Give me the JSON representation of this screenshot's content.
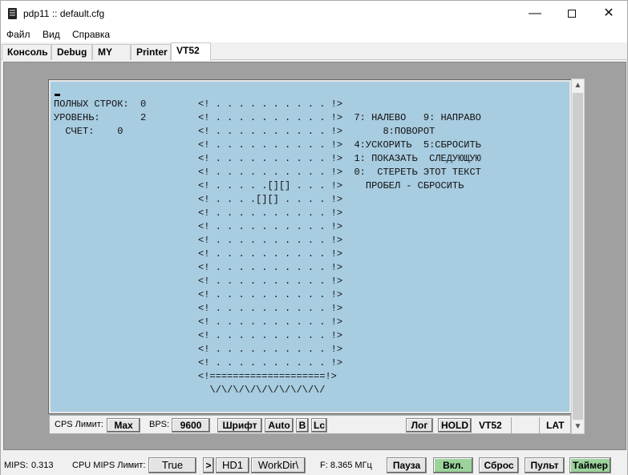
{
  "window": {
    "title": "pdp11 :: default.cfg",
    "minimize": "—",
    "close": "✕"
  },
  "menu": [
    "Файл",
    "Вид",
    "Справка"
  ],
  "tabs": [
    "Консоль",
    "Debug",
    "MY",
    "Printer",
    "VT52"
  ],
  "active_tab": "VT52",
  "terminal": {
    "lines": [
      "ПОЛНЫХ СТРОК:  0         <! . . . . . . . . . . !>",
      "УРОВЕНЬ:       2         <! . . . . . . . . . . !>  7: НАЛЕВО   9: НАПРАВО",
      "  СЧЕТ:    0             <! . . . . . . . . . . !>       8:ПОВОРОТ",
      "                         <! . . . . . . . . . . !>  4:УСКОРИТЬ  5:СБРОСИТЬ",
      "                         <! . . . . . . . . . . !>  1: ПОКАЗАТЬ  СЛЕДУЮЩУЮ",
      "                         <! . . . . . . . . . . !>  0:  СТЕРЕТЬ ЭТОТ ТЕКСТ",
      "                         <! . . . . .[][] . . . !>    ПРОБЕЛ - СБРОСИТЬ",
      "                         <! . . . .[][] . . . . !>",
      "                         <! . . . . . . . . . . !>",
      "                         <! . . . . . . . . . . !>",
      "                         <! . . . . . . . . . . !>",
      "                         <! . . . . . . . . . . !>",
      "                         <! . . . . . . . . . . !>",
      "                         <! . . . . . . . . . . !>",
      "                         <! . . . . . . . . . . !>",
      "                         <! . . . . . . . . . . !>",
      "                         <! . . . . . . . . . . !>",
      "                         <! . . . . . . . . . . !>",
      "                         <! . . . . . . . . . . !>",
      "                         <! . . . . . . . . . . !>",
      "                         <!====================!>",
      "                           \\/\\/\\/\\/\\/\\/\\/\\/\\/\\/"
    ],
    "screen_color": "#a8cce0"
  },
  "termbar": {
    "cps_label": "CPS Лимит:",
    "cps_value": "Max",
    "bps_label": "BPS:",
    "bps_value": "9600",
    "font_button": "Шрифт",
    "auto_button": "Auto",
    "b_button": "B",
    "lc_button": "Lc",
    "log_button": "Лог",
    "hold_button": "HOLD",
    "vt52_label": "VT52",
    "lat_label": "LAT"
  },
  "statusbar": {
    "mips_label": "MIPS:",
    "mips_value": "0.313",
    "cpu_limit_label": "CPU MIPS Лимит:",
    "cpu_limit_value": "True",
    "arrow_button": ">",
    "hd_button": "HD1",
    "workdir_button": "WorkDir\\",
    "freq_label": "F: 8.365 МГц",
    "pause_button": "Пауза",
    "on_button": "Вкл.",
    "reset_button": "Сброс",
    "console_button": "Пульт",
    "timer_button": "Таймер"
  },
  "colors": {
    "active_green": "#9bd39b",
    "screen": "#a8cce0"
  }
}
